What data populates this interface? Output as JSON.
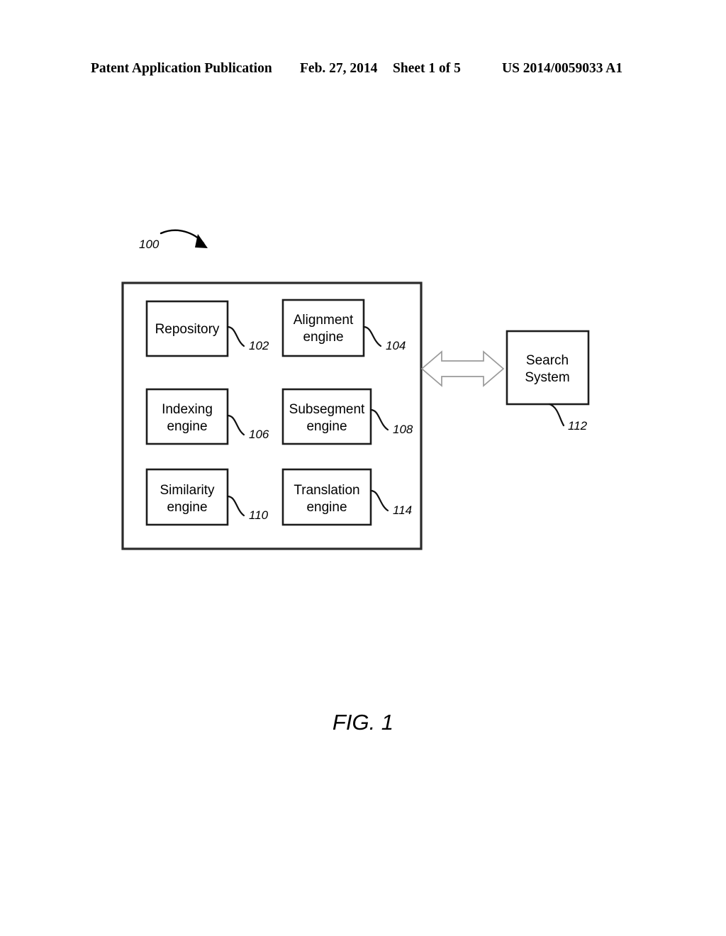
{
  "header": {
    "publication": "Patent Application Publication",
    "date": "Feb. 27, 2014",
    "sheet": "Sheet 1 of 5",
    "patent_number": "US 2014/0059033 A1"
  },
  "figure": {
    "caption": "FIG. 1",
    "system_reference": "100",
    "container": {
      "name": "translation-memory-system",
      "reference": "100"
    },
    "components": [
      {
        "label_line1": "Repository",
        "label_line2": "",
        "reference": "102"
      },
      {
        "label_line1": "Alignment",
        "label_line2": "engine",
        "reference": "104"
      },
      {
        "label_line1": "Indexing",
        "label_line2": "engine",
        "reference": "106"
      },
      {
        "label_line1": "Subsegment",
        "label_line2": "engine",
        "reference": "108"
      },
      {
        "label_line1": "Similarity",
        "label_line2": "engine",
        "reference": "110"
      },
      {
        "label_line1": "Translation",
        "label_line2": "engine",
        "reference": "114"
      }
    ],
    "external": {
      "label_line1": "Search",
      "label_line2": "System",
      "reference": "112"
    },
    "connector": {
      "name": "bidirectional-arrow",
      "direction": "both"
    }
  },
  "colors": {
    "ink": "#000000",
    "box_stroke": "#1d1d1d",
    "outer_stroke": "#2b2b2b",
    "arrow_stroke": "#9a9a9a",
    "page_background": "#ffffff"
  }
}
